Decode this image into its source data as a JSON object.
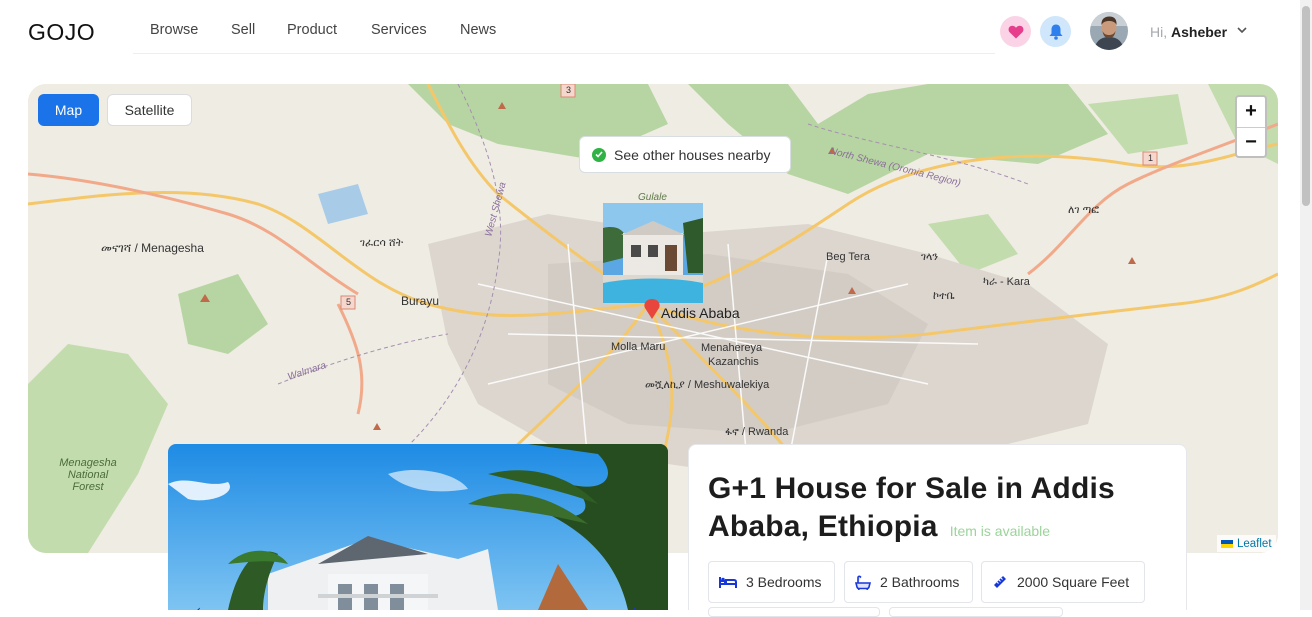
{
  "header": {
    "logo": "GOJO",
    "nav": [
      "Browse",
      "Sell",
      "Product",
      "Services",
      "News"
    ],
    "greeting_prefix": "Hi,",
    "user_name": "Asheber",
    "colors": {
      "heart_bg": "#fbd3e6",
      "heart": "#e63d8c",
      "bell_bg": "#cfe6fb",
      "bell": "#2f80ed"
    }
  },
  "map": {
    "types": {
      "map": "Map",
      "satellite": "Satellite"
    },
    "zoom_in": "+",
    "zoom_out": "−",
    "nearby_label": "See other houses nearby",
    "attribution": "Leaflet",
    "city_label": "Addis Ababa",
    "places": [
      {
        "label": "መናገሻ / Menagesha"
      },
      {
        "label": "ገፈርሳ ሸት"
      },
      {
        "label": "Burayu"
      },
      {
        "label": "Beg Tera"
      },
      {
        "label": "ገላን"
      },
      {
        "label": "ኮተቤ"
      },
      {
        "label": "ካራ - Kara"
      },
      {
        "label": "Menahereya"
      },
      {
        "label": "Kazanchis"
      },
      {
        "label": "Molla Maru"
      },
      {
        "label": "መሿለኪያ / Meshuwalekiya"
      },
      {
        "label": "ፋኖ / Rwanda"
      },
      {
        "label": "Menagesha National Forest"
      },
      {
        "label": "Walmara"
      },
      {
        "label": "North Shewa (Oromia Region)"
      },
      {
        "label": "Gulale"
      },
      {
        "label": "West Shewa"
      },
      {
        "label": "ለገ ጣፎ"
      }
    ],
    "route_numbers": [
      "3",
      "5",
      "1"
    ]
  },
  "listing": {
    "title": "G+1 House for Sale in Addis Ababa, Ethiopia",
    "availability": "Item is available",
    "features": [
      {
        "icon": "bed-icon",
        "label": "3 Bedrooms"
      },
      {
        "icon": "bath-icon",
        "label": "2 Bathrooms"
      },
      {
        "icon": "ruler-icon",
        "label": "2000 Square Feet"
      }
    ],
    "accent": "#1837d9"
  }
}
